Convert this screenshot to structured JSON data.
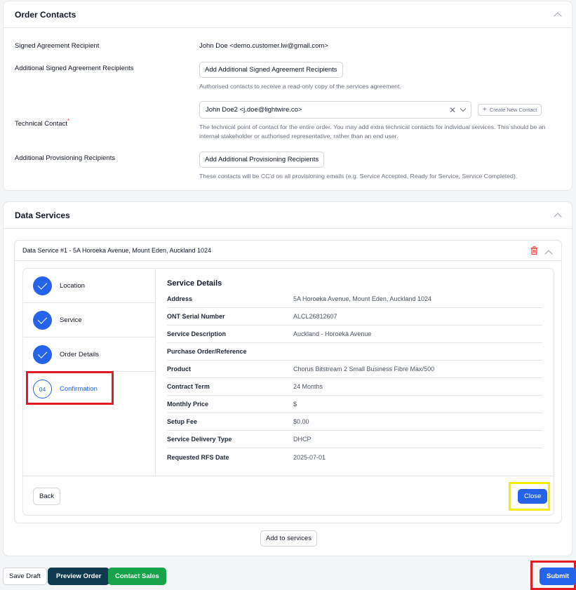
{
  "order_contacts": {
    "title": "Order Contacts",
    "signed_agreement_label": "Signed Agreement Recipient",
    "signed_agreement_value": "John Doe <demo.customer.lw@gmail.com>",
    "additional_signed_label": "Additional Signed Agreement Recipients",
    "additional_signed_button": "Add Additional Signed Agreement Recipients",
    "additional_signed_hint": "Authorised contacts to receive a read-only copy of the services agreement.",
    "technical_label": "Technical Contact",
    "technical_required": "*",
    "technical_value": "John Doe2 <j.doe@lightwire.co>",
    "create_contact_button": "Create New Contact",
    "technical_hint": "The technical point of contact for the entire order. You may add extra technical contacts for individual services. This should be an internal stakeholder or authorised representative, rather than an end user.",
    "provisioning_label": "Additional Provisioning Recipients",
    "provisioning_button": "Add Additional Provisioning Recipients",
    "provisioning_hint": "These contacts will be CC'd on all provisioning emails (e.g. Service Accepted, Ready for Service, Service Completed)."
  },
  "data_services": {
    "title": "Data Services",
    "service_title": "Data Service #1 - 5A Horoeka Avenue, Mount Eden, Auckland 1024",
    "steps": [
      {
        "label": "Location",
        "done": true
      },
      {
        "label": "Service",
        "done": true
      },
      {
        "label": "Order Details",
        "done": true
      },
      {
        "label": "Confirmation",
        "number": "04",
        "done": false
      }
    ],
    "details_title": "Service Details",
    "details": [
      {
        "key": "Address",
        "value": "5A Horoeka Avenue, Mount Eden, Auckland 1024"
      },
      {
        "key": "ONT Serial Number",
        "value": "ALCL26812607"
      },
      {
        "key": "Service Description",
        "value": "Auckland - Horoeka Avenue"
      },
      {
        "key": "Purchase Order/Reference",
        "value": ""
      },
      {
        "key": "Product",
        "value": "Chorus Bitstream 2 Small Business Fibre Max/500"
      },
      {
        "key": "Contract Term",
        "value": "24 Months"
      },
      {
        "key": "Monthly Price",
        "value": "$"
      },
      {
        "key": "Setup Fee",
        "value": "$0.00"
      },
      {
        "key": "Service Delivery Type",
        "value": "DHCP"
      },
      {
        "key": "Requested RFS Date",
        "value": "2025-07-01"
      }
    ],
    "back_button": "Back",
    "close_button": "Close",
    "add_to_services_button": "Add to services"
  },
  "footer": {
    "save_draft": "Save Draft",
    "preview_order": "Preview Order",
    "contact_sales": "Contact Sales",
    "submit": "Submit"
  },
  "colors": {
    "primary": "#2563eb",
    "dark_button": "#0f3a4f",
    "green_button": "#16a34a",
    "highlight_red": "#e31b23",
    "highlight_yellow": "#f5ec00",
    "delete_red": "#ef4444"
  }
}
